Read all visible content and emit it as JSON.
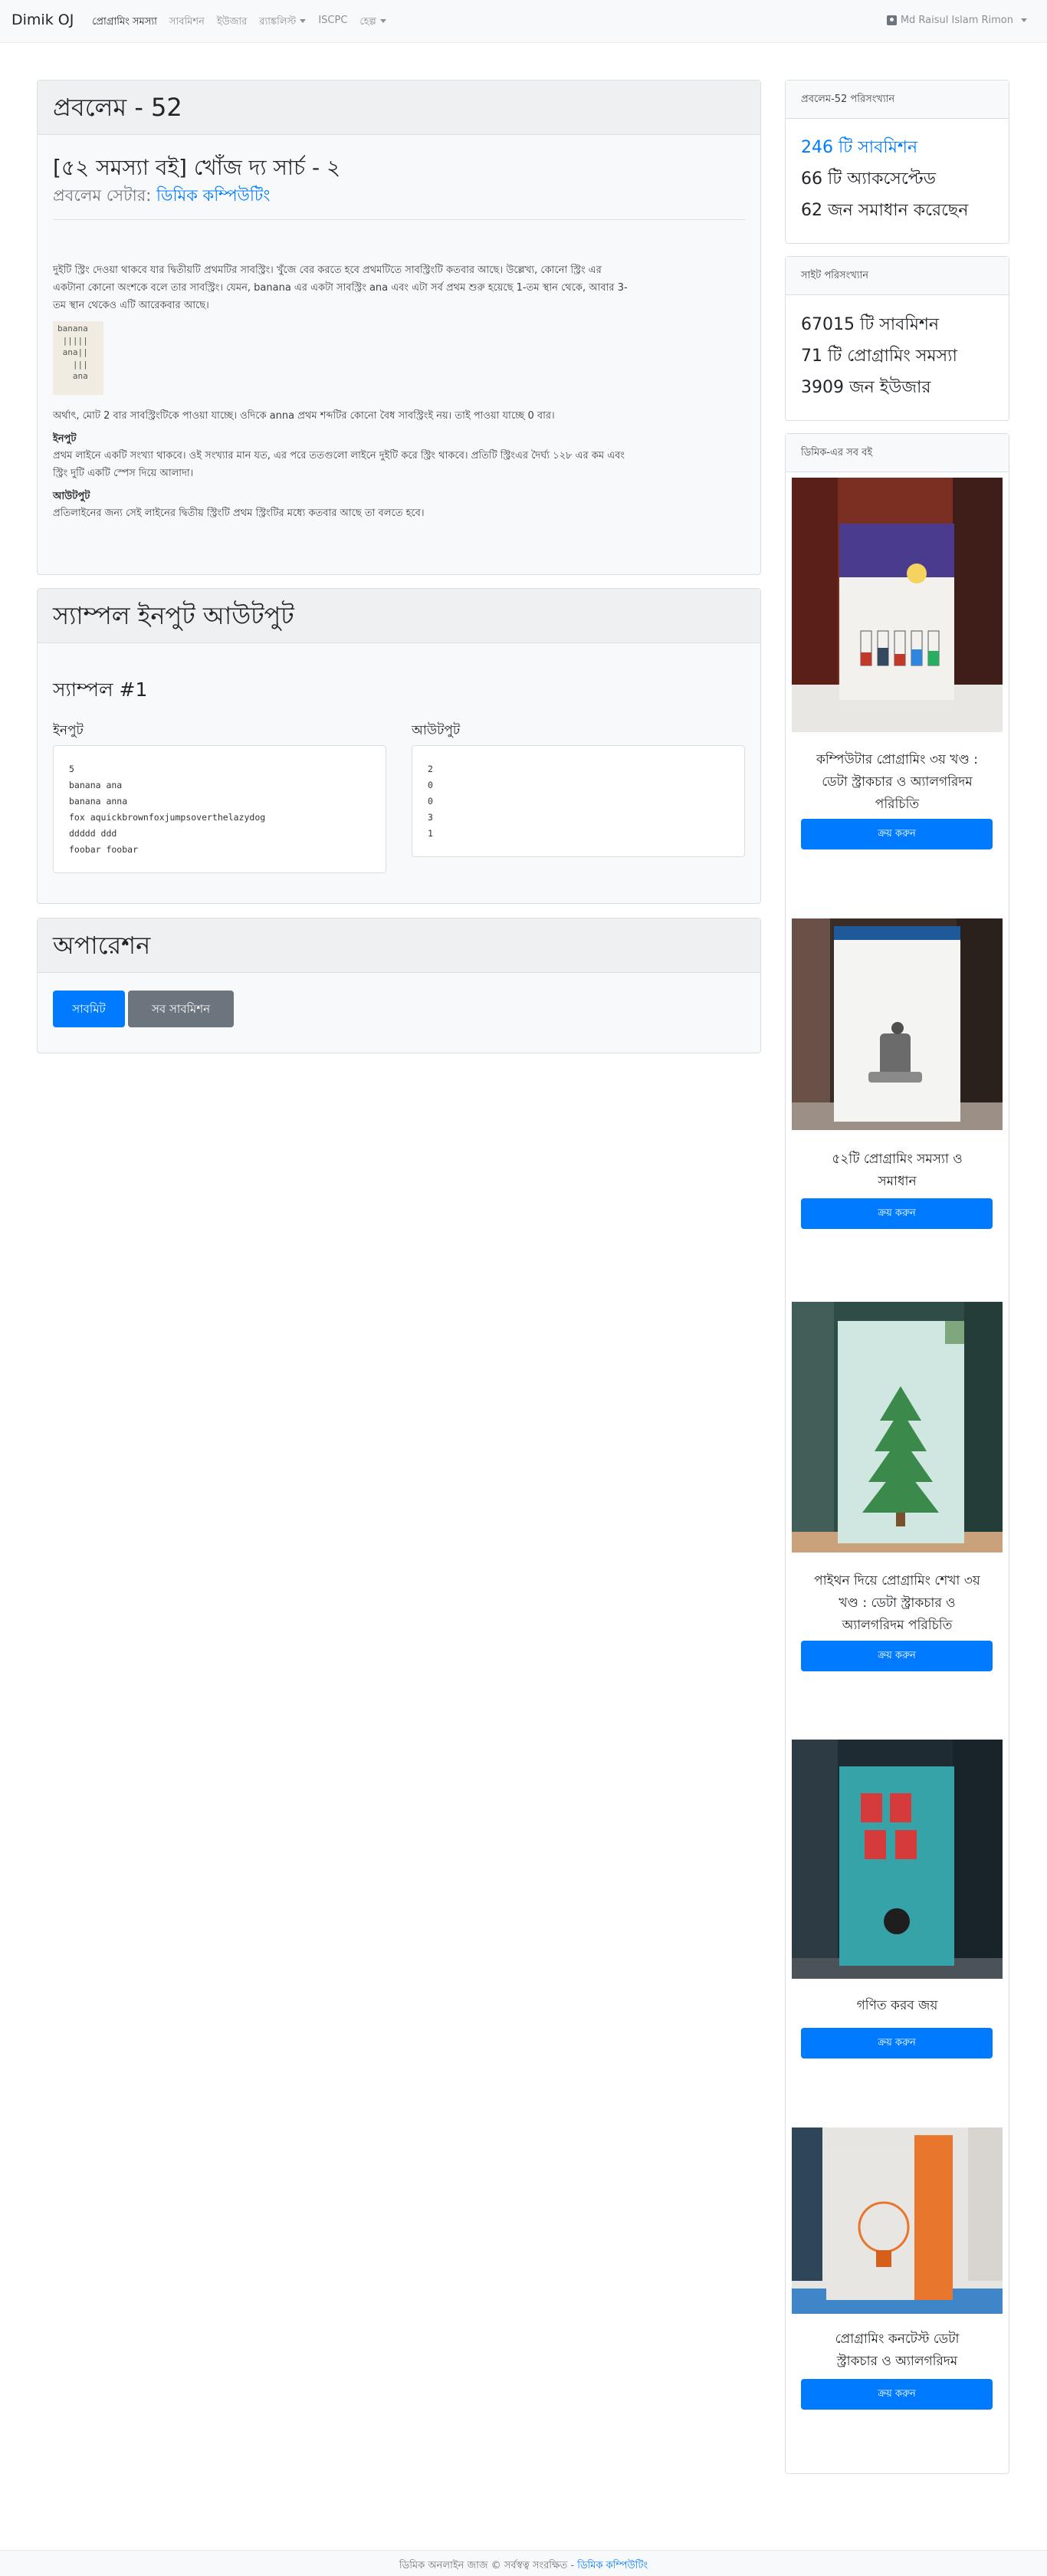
{
  "navbar": {
    "brand": "Dimik OJ",
    "items": [
      {
        "label": "প্রোগ্রামিং সমস্যা",
        "active": true,
        "dropdown": false
      },
      {
        "label": "সাবমিশন",
        "active": false,
        "dropdown": false
      },
      {
        "label": "ইউজার",
        "active": false,
        "dropdown": false
      },
      {
        "label": "র‍্যাঙ্কলিস্ট",
        "active": false,
        "dropdown": true
      },
      {
        "label": "ISCPC",
        "active": false,
        "dropdown": false
      },
      {
        "label": "হেল্প",
        "active": false,
        "dropdown": true
      }
    ],
    "user": "Md Raisul Islam Rimon"
  },
  "problem": {
    "header": "প্রবলেম - 52",
    "title": "[৫২ সমস্যা বই] খোঁজ দ্য সার্চ - ২",
    "setter_label": "প্রবলেম সেটার:",
    "setter_name": "ডিমিক কম্পিউটিং",
    "statement_lines": [
      "দুইটি স্ট্রিং দেওয়া থাকবে যার দ্বিতীয়টি প্রথমটির সাবস্ট্রিং। খুঁজে বের করতে হবে প্রথমটিতে সাবস্ট্রিংটি কতবার আছে। উল্লেখ্য, কোনো স্ট্রিং এর",
      "একটানা কোনো অংশকে বলে তার সাবস্ট্রিং। যেমন, banana এর একটা সাবস্ট্রিং ana এবং এটা সর্ব প্রথম শুরু হয়েছে 1-তম স্থান থেকে, আবার 3-",
      "তম স্থান থেকেও এটি আরেকবার আছে।"
    ],
    "example_lines": [
      "banana",
      " |||||",
      " ana||",
      "   |||",
      "   ana"
    ],
    "conclusion": "অর্থাৎ, মোট 2 বার সাবস্ট্রিংটিকে পাওয়া যাচ্ছে। ওদিকে anna প্রথম শব্দটির কোনো বৈধ সাবস্ট্রিংই নয়। তাই পাওয়া যাচ্ছে 0 বার।",
    "input_title": "ইনপুট",
    "input_lines": [
      "প্রথম লাইনে একটি সংখ্যা থাকবে। ওই সংখ্যার মান যত, এর পরে ততগুলো লাইনে দুইটি করে স্ট্রিং থাকবে। প্রতিটি স্ট্রিংএর দৈর্ঘ্য ১২৮ এর কম এবং",
      "স্ট্রিং দুটি একটি স্পেস দিয়ে আলাদা।"
    ],
    "output_title": "আউটপুট",
    "output_text": "প্রতিলাইনের জন্য সেই লাইনের দ্বিতীয় স্ট্রিংটি প্রথম স্ট্রিংটির মধ্যে কতবার আছে তা বলতে হবে।"
  },
  "sample": {
    "header": "স্যাম্পল ইনপুট আউটপুট",
    "subtitle": "স্যাম্পল #1",
    "input_label": "ইনপুট",
    "output_label": "আউটপুট",
    "input_lines": [
      "5",
      "banana ana",
      "banana anna",
      "fox aquickbrownfoxjumpsoverthelazydog",
      "ddddd ddd",
      "foobar foobar"
    ],
    "output_lines": [
      "2",
      "0",
      "0",
      "3",
      "1"
    ]
  },
  "operations": {
    "header": "অপারেশন",
    "submit_label": "সাবমিট",
    "all_submissions_label": "সব সাবমিশন"
  },
  "problem_stats": {
    "header": "প্রবলেম-52 পরিসংখ্যান",
    "submissions": "246 টি সাবমিশন",
    "accepted": "66 টি অ্যাকসেপ্টেড",
    "solvers": "62 জন সমাধান করেছেন"
  },
  "site_stats": {
    "header": "সাইট পরিসংখ্যান",
    "submissions": "67015 টি সাবমিশন",
    "problems": "71 টি প্রোগ্রামিং সমস্যা",
    "users": "3909 জন ইউজার"
  },
  "books": {
    "header": "ডিমিক-এর সব বই",
    "buy_label": "ক্রয় করুন",
    "items": [
      {
        "title_lines": [
          "কম্পিউটার প্রোগ্রামিং ৩য় খণ্ড :",
          "ডেটা স্ট্রাকচার ও অ্যালগরিদম",
          "পরিচিতি"
        ],
        "cover_title": "কম্পিউটার প্রোগ্রামিং",
        "cover_sub": "ডেটা স্ট্রাকচার ও অ্যালগরিদম পরিচিতি"
      },
      {
        "title_lines": [
          "৫২টি প্রোগ্রামিং সমস্যা ও",
          "সমাধান"
        ],
        "cover_title": "৫২টি প্রোগ্রামিং সমস্যা ও সমাধান",
        "cover_sub": ""
      },
      {
        "title_lines": [
          "পাইথন দিয়ে প্রোগ্রামিং শেখা ৩য়",
          "খণ্ড : ডেটা স্ট্রাকচার ও",
          "অ্যালগরিদম পরিচিতি"
        ],
        "cover_title": "পাইথন দিয়ে প্রোগ্রামিং শেখা",
        "cover_sub": "ডেটা স্ট্রাকচার ও অ্যালগরিদম পরিচিতি"
      },
      {
        "title_lines": [
          "গণিত করব জয়"
        ],
        "cover_title": "গণিত করব জয়",
        "cover_sub": ""
      },
      {
        "title_lines": [
          "প্রোগ্রামিং কনটেস্ট ডেটা",
          "স্ট্রাকচার ও অ্যালগরিদম"
        ],
        "cover_title": "প্রোগ্রামিং কনটেস্ট",
        "cover_sub": "ডেটা স্ট্রাকচার ও অ্যালগরিদম"
      }
    ]
  },
  "footer": {
    "text": "ডিমিক অনলাইন জাজ © সর্বস্বত্ব সংরক্ষিত -",
    "link": "ডিমিক কম্পিউটিং"
  },
  "colors": {
    "primary": "#007bff",
    "secondary": "#6c757d",
    "navbar_bg": "#f8f9fa"
  }
}
